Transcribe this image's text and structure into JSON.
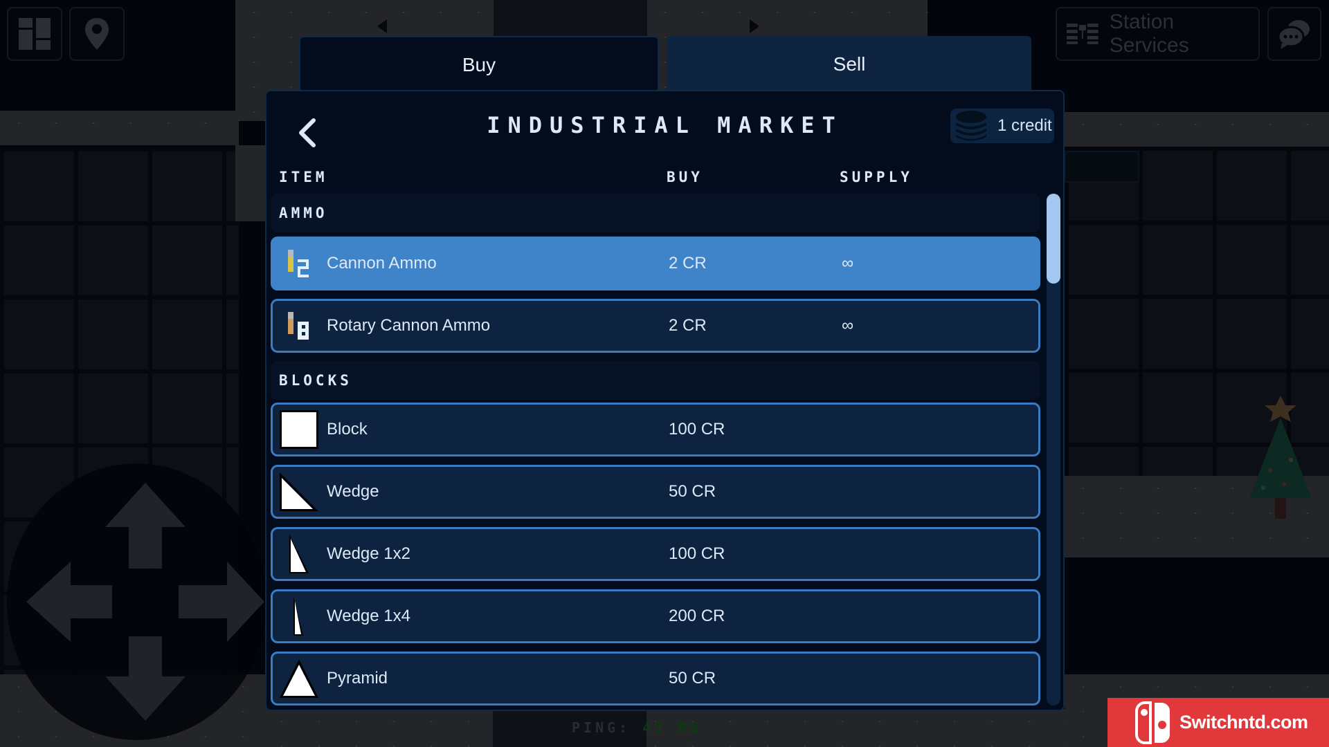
{
  "hud": {
    "layout_button_icon": "layout-grid-icon",
    "map_pin_icon": "map-pin-icon",
    "station_services_label": "Station Services",
    "chat_icon": "chat-bubbles-icon"
  },
  "tabs": [
    {
      "label": "Buy",
      "active": true
    },
    {
      "label": "Sell",
      "active": false
    }
  ],
  "market": {
    "title": "INDUSTRIAL MARKET",
    "back_icon": "chevron-left-icon",
    "credits": "1 credit",
    "credits_icon": "coin-stack-icon",
    "columns": {
      "item": "ITEM",
      "buy": "BUY",
      "supply": "SUPPLY"
    },
    "categories": [
      {
        "name": "AMMO",
        "items": [
          {
            "name": "Cannon Ammo",
            "price": "2 CR",
            "supply": "∞",
            "icon": "cannon-ammo-icon",
            "selected": true
          },
          {
            "name": "Rotary Cannon Ammo",
            "price": "2 CR",
            "supply": "∞",
            "icon": "rotary-ammo-icon",
            "selected": false
          }
        ]
      },
      {
        "name": "BLOCKS",
        "items": [
          {
            "name": "Block",
            "price": "100 CR",
            "supply": "",
            "icon": "block-icon",
            "selected": false
          },
          {
            "name": "Wedge",
            "price": "50 CR",
            "supply": "",
            "icon": "wedge-icon",
            "selected": false
          },
          {
            "name": "Wedge 1x2",
            "price": "100 CR",
            "supply": "",
            "icon": "wedge-1x2-icon",
            "selected": false
          },
          {
            "name": "Wedge 1x4",
            "price": "200 CR",
            "supply": "",
            "icon": "wedge-1x4-icon",
            "selected": false
          },
          {
            "name": "Pyramid",
            "price": "50 CR",
            "supply": "",
            "icon": "pyramid-icon",
            "selected": false
          }
        ]
      }
    ],
    "scroll_position": 0.0
  },
  "status": {
    "ping_label": "PING:",
    "ping_value": "45 MS"
  },
  "watermark": {
    "text": "Switchntd.com"
  },
  "colors": {
    "panel_bg": "#030c1d",
    "row_bg": "#0e2340",
    "row_border": "#3a7cc4",
    "row_selected": "#3f84c9",
    "scroll_thumb": "#a3c9f3",
    "watermark_red": "#e1383b"
  }
}
